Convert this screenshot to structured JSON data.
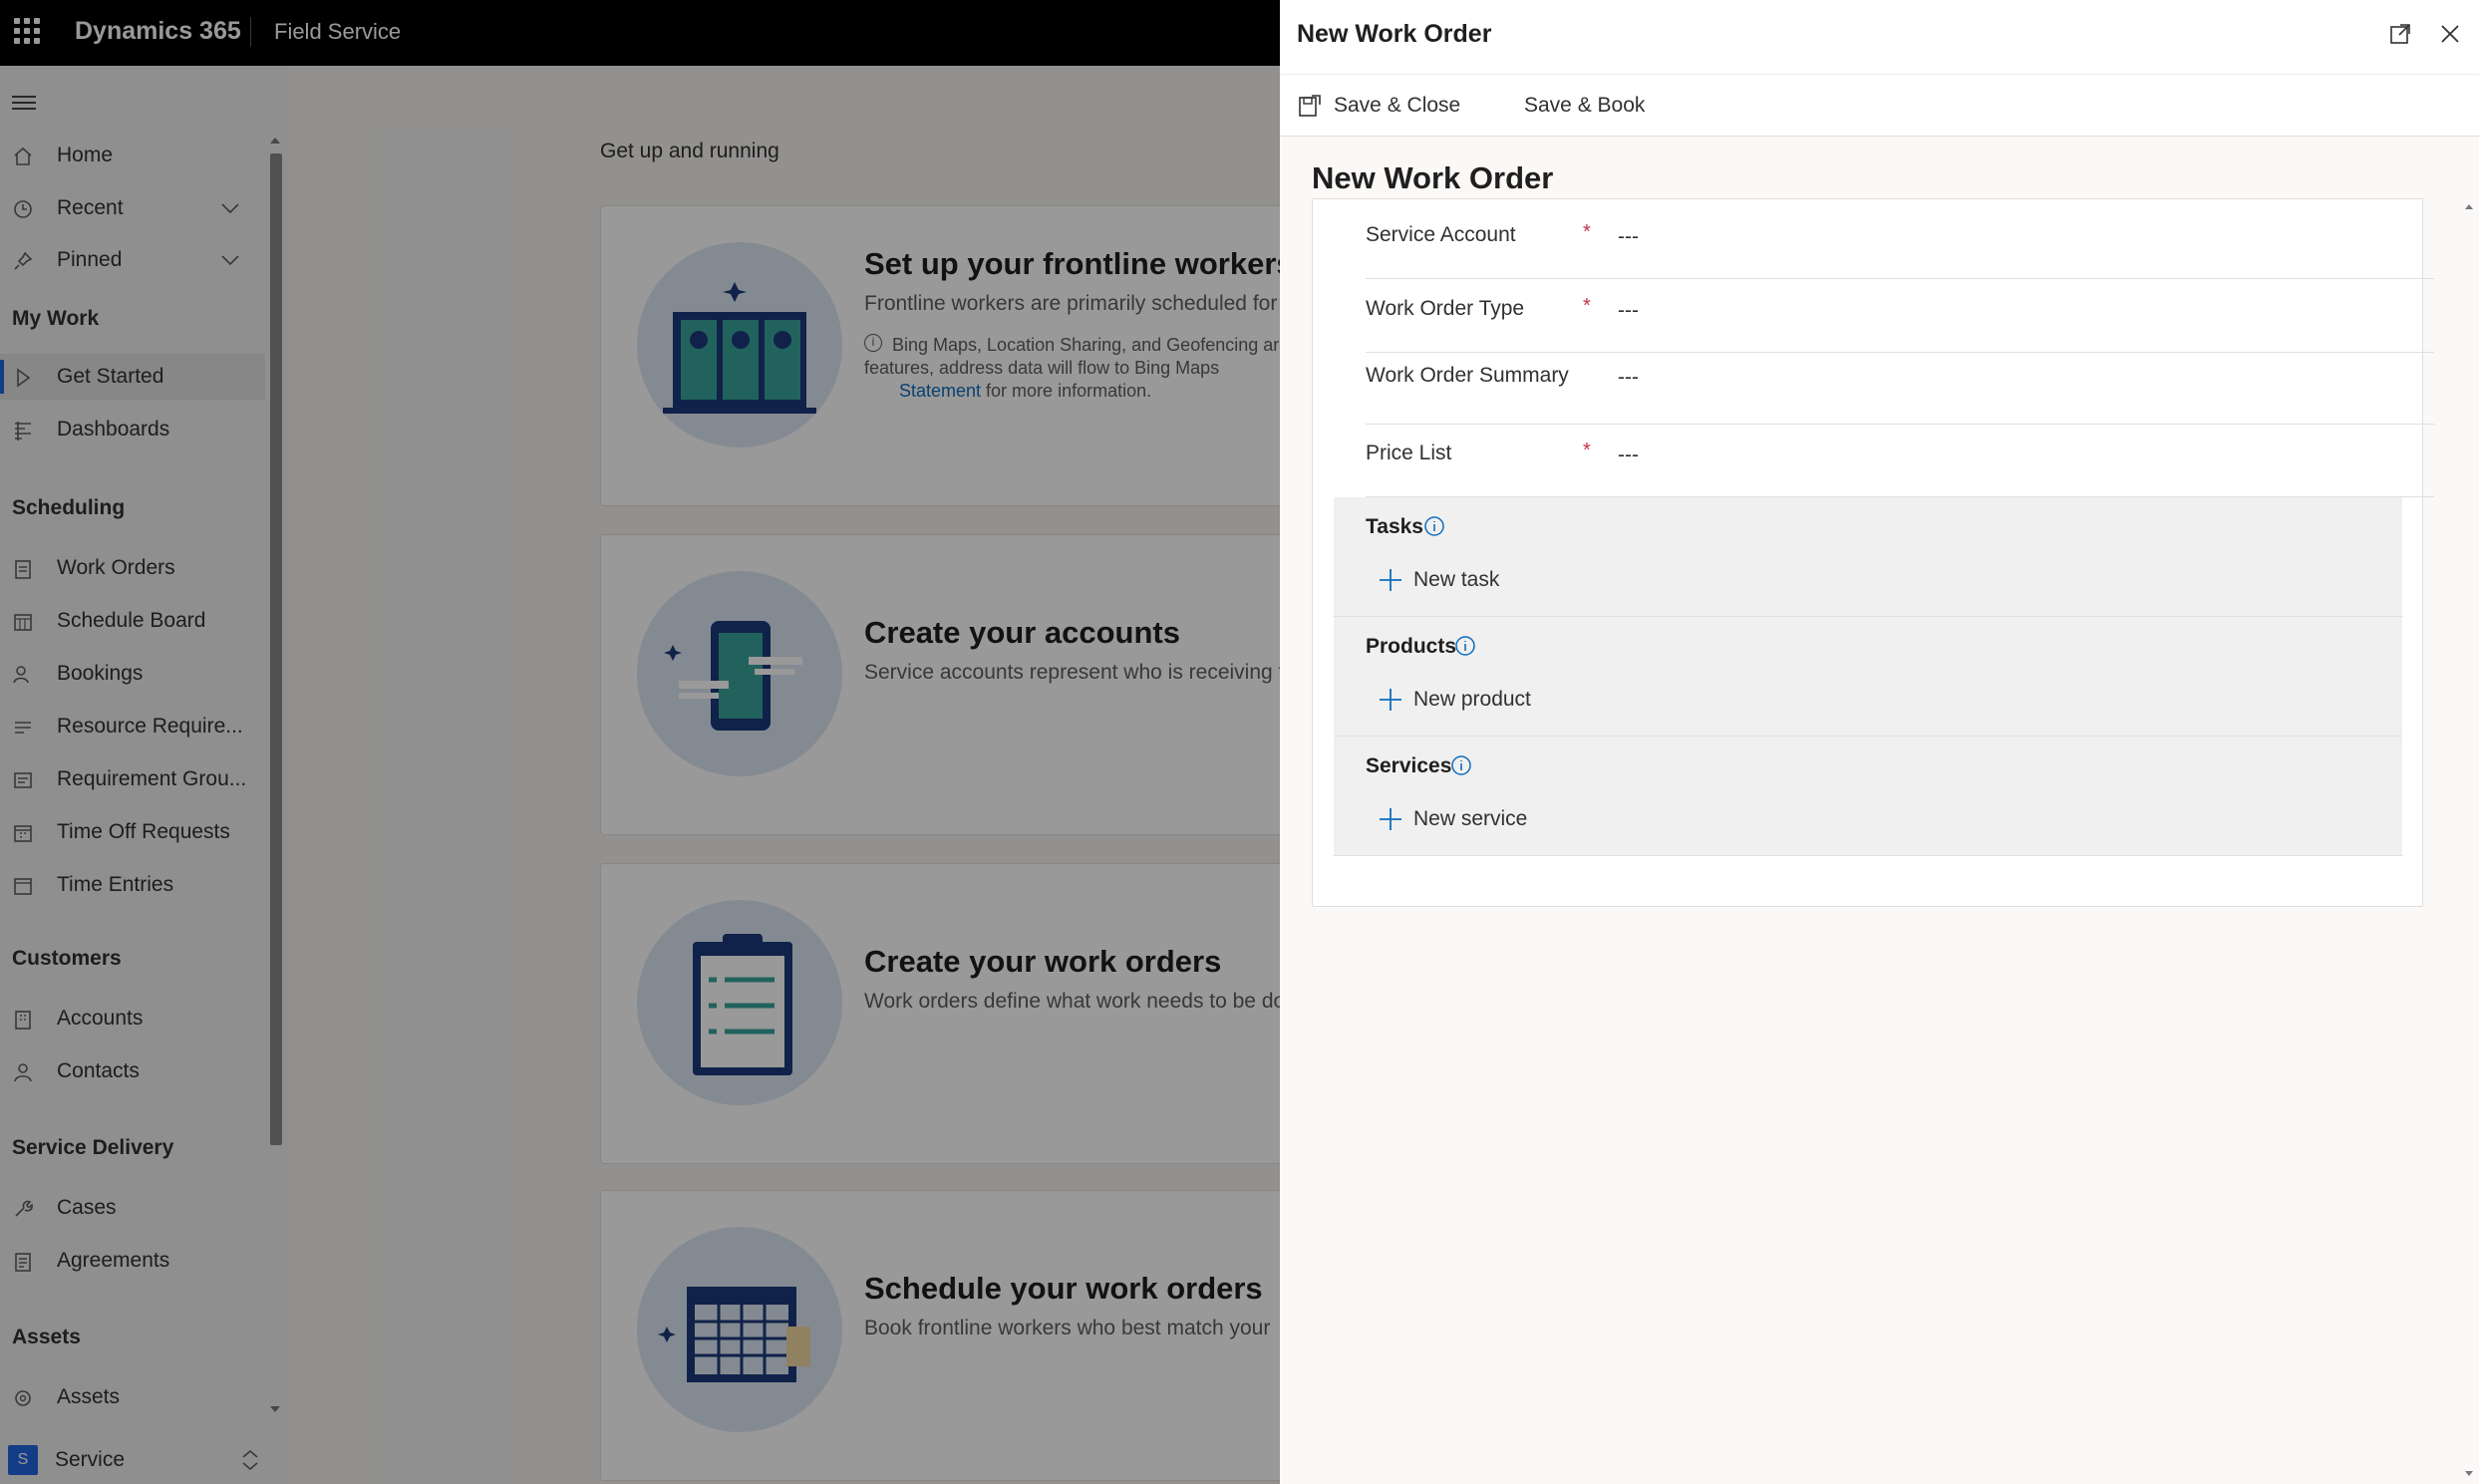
{
  "topbar": {
    "app_name": "Dynamics 365",
    "module_name": "Field Service"
  },
  "sidebar": {
    "home": "Home",
    "recent": "Recent",
    "pinned": "Pinned",
    "groups": {
      "my_work": "My Work",
      "scheduling": "Scheduling",
      "customers": "Customers",
      "service_delivery": "Service Delivery",
      "assets": "Assets"
    },
    "items": {
      "get_started": "Get Started",
      "dashboards": "Dashboards",
      "work_orders": "Work Orders",
      "schedule_board": "Schedule Board",
      "bookings": "Bookings",
      "resource_requirements": "Resource Require...",
      "requirement_groups": "Requirement Grou...",
      "time_off_requests": "Time Off Requests",
      "time_entries": "Time Entries",
      "accounts": "Accounts",
      "contacts": "Contacts",
      "cases": "Cases",
      "agreements": "Agreements",
      "assets": "Assets"
    },
    "area": {
      "badge": "S",
      "label": "Service"
    }
  },
  "main": {
    "heading": "Get up and running",
    "cards": [
      {
        "title": "Set up your frontline workers",
        "desc": "Frontline workers are primarily scheduled for",
        "note_text": "Bing Maps, Location Sharing, and Geofencing ar etc features, address data will flow to Bing Maps",
        "note_link": "Statement",
        "note_tail": " for more information."
      },
      {
        "title": "Create your accounts",
        "desc": "Service accounts represent who is receiving t"
      },
      {
        "title": "Create your work orders",
        "desc": "Work orders define what work needs to be do"
      },
      {
        "title": "Schedule your work orders",
        "desc": "Book frontline workers who best match your"
      }
    ]
  },
  "panel": {
    "title": "New Work Order",
    "commands": {
      "save_close": "Save & Close",
      "save_book": "Save & Book"
    },
    "form_title": "New Work Order",
    "fields": [
      {
        "label": "Service Account",
        "required": "*",
        "value": "---"
      },
      {
        "label": "Work Order Type",
        "required": "*",
        "value": "---"
      },
      {
        "label": "Work Order Summary",
        "required": "",
        "value": "---"
      },
      {
        "label": "Price List",
        "required": "*",
        "value": "---"
      }
    ],
    "subgrids": [
      {
        "title": "Tasks",
        "new_label": "New task"
      },
      {
        "title": "Products",
        "new_label": "New product"
      },
      {
        "title": "Services",
        "new_label": "New service"
      }
    ]
  },
  "colors": {
    "accent": "#2266e3",
    "required": "#c4314b",
    "link": "#0f6cbd",
    "topbar": "#000000"
  }
}
